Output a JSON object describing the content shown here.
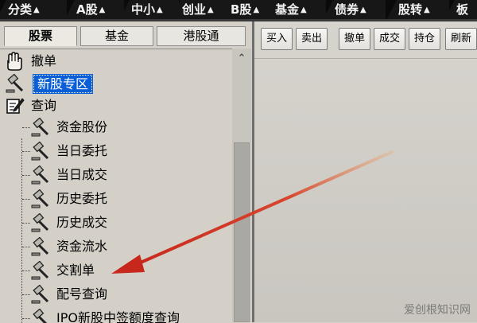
{
  "top_tabs": [
    {
      "label": "分类",
      "arrow": "▲"
    },
    {
      "label": "A股",
      "arrow": "▲"
    },
    {
      "label": "中小",
      "arrow": "▲"
    },
    {
      "label": "创业",
      "arrow": "▲"
    },
    {
      "label": "B股",
      "arrow": "▲"
    },
    {
      "label": "基金",
      "arrow": "▲"
    },
    {
      "label": "债券",
      "arrow": "▲"
    },
    {
      "label": "股转",
      "arrow": "▲"
    },
    {
      "label": "板",
      "arrow": ""
    }
  ],
  "sub_tabs": [
    {
      "label": "股票",
      "active": true
    },
    {
      "label": "基金",
      "active": false
    },
    {
      "label": "港股通",
      "active": false
    }
  ],
  "tree": {
    "top_nodes": [
      {
        "label": "撤单",
        "icon": "hand-icon"
      },
      {
        "label": "新股专区",
        "icon": "gavel-icon",
        "selected": true
      },
      {
        "label": "查询",
        "icon": "edit-note-icon"
      }
    ],
    "query_children": [
      {
        "label": "资金股份"
      },
      {
        "label": "当日委托"
      },
      {
        "label": "当日成交"
      },
      {
        "label": "历史委托"
      },
      {
        "label": "历史成交"
      },
      {
        "label": "资金流水"
      },
      {
        "label": "交割单"
      },
      {
        "label": "配号查询"
      },
      {
        "label": "IPO新股中签额度查询"
      }
    ]
  },
  "scroll_up_glyph": "⌃",
  "toolbar": {
    "buttons": [
      {
        "label": "买入"
      },
      {
        "label": "卖出"
      },
      {
        "label": "撤单"
      },
      {
        "label": "成交"
      },
      {
        "label": "持仓"
      },
      {
        "label": "刷新"
      }
    ]
  },
  "watermark": "爱创根知识网",
  "colors": {
    "selection": "#0a5fd6",
    "annotation_arrow": "#d63a2a",
    "topbar_bg": "#0a0a0a"
  }
}
